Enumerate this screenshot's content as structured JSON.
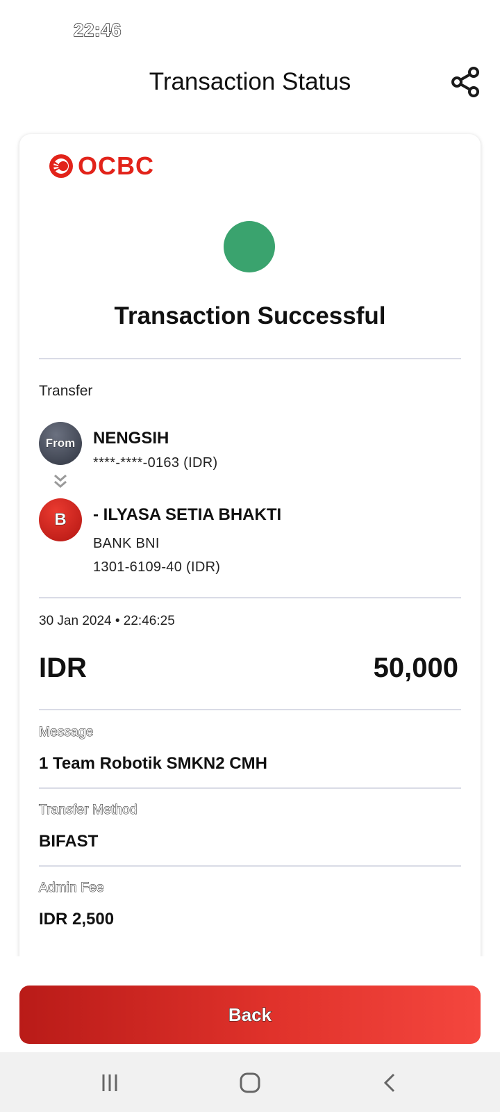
{
  "status_bar": {
    "time": "22:46"
  },
  "header": {
    "title": "Transaction Status",
    "share_icon": "share-icon"
  },
  "card": {
    "bank_logo": "OCBC",
    "status_title": "Transaction Successful",
    "status_color": "#3aa36e",
    "section_label": "Transfer",
    "from": {
      "avatar_label": "From",
      "name": "NENGSIH",
      "account": "****-****-0163 (IDR)"
    },
    "to": {
      "avatar_label": "B",
      "name": "- ILYASA SETIA BHAKTI",
      "bank": "BANK BNI",
      "account": "1301-6109-40 (IDR)"
    },
    "datetime": "30 Jan 2024 • 22:46:25",
    "amount": {
      "currency": "IDR",
      "value": "50,000"
    },
    "details": [
      {
        "label": "Message",
        "value": "1 Team Robotik SMKN2 CMH"
      },
      {
        "label": "Transfer Method",
        "value": "BIFAST"
      },
      {
        "label": "Admin Fee",
        "value": "IDR 2,500"
      }
    ]
  },
  "footer": {
    "back_label": "Back",
    "accent": "#e0322b"
  },
  "nav": {
    "recents_icon": "recents-icon",
    "home_icon": "home-icon",
    "back_icon": "back-nav-icon"
  }
}
